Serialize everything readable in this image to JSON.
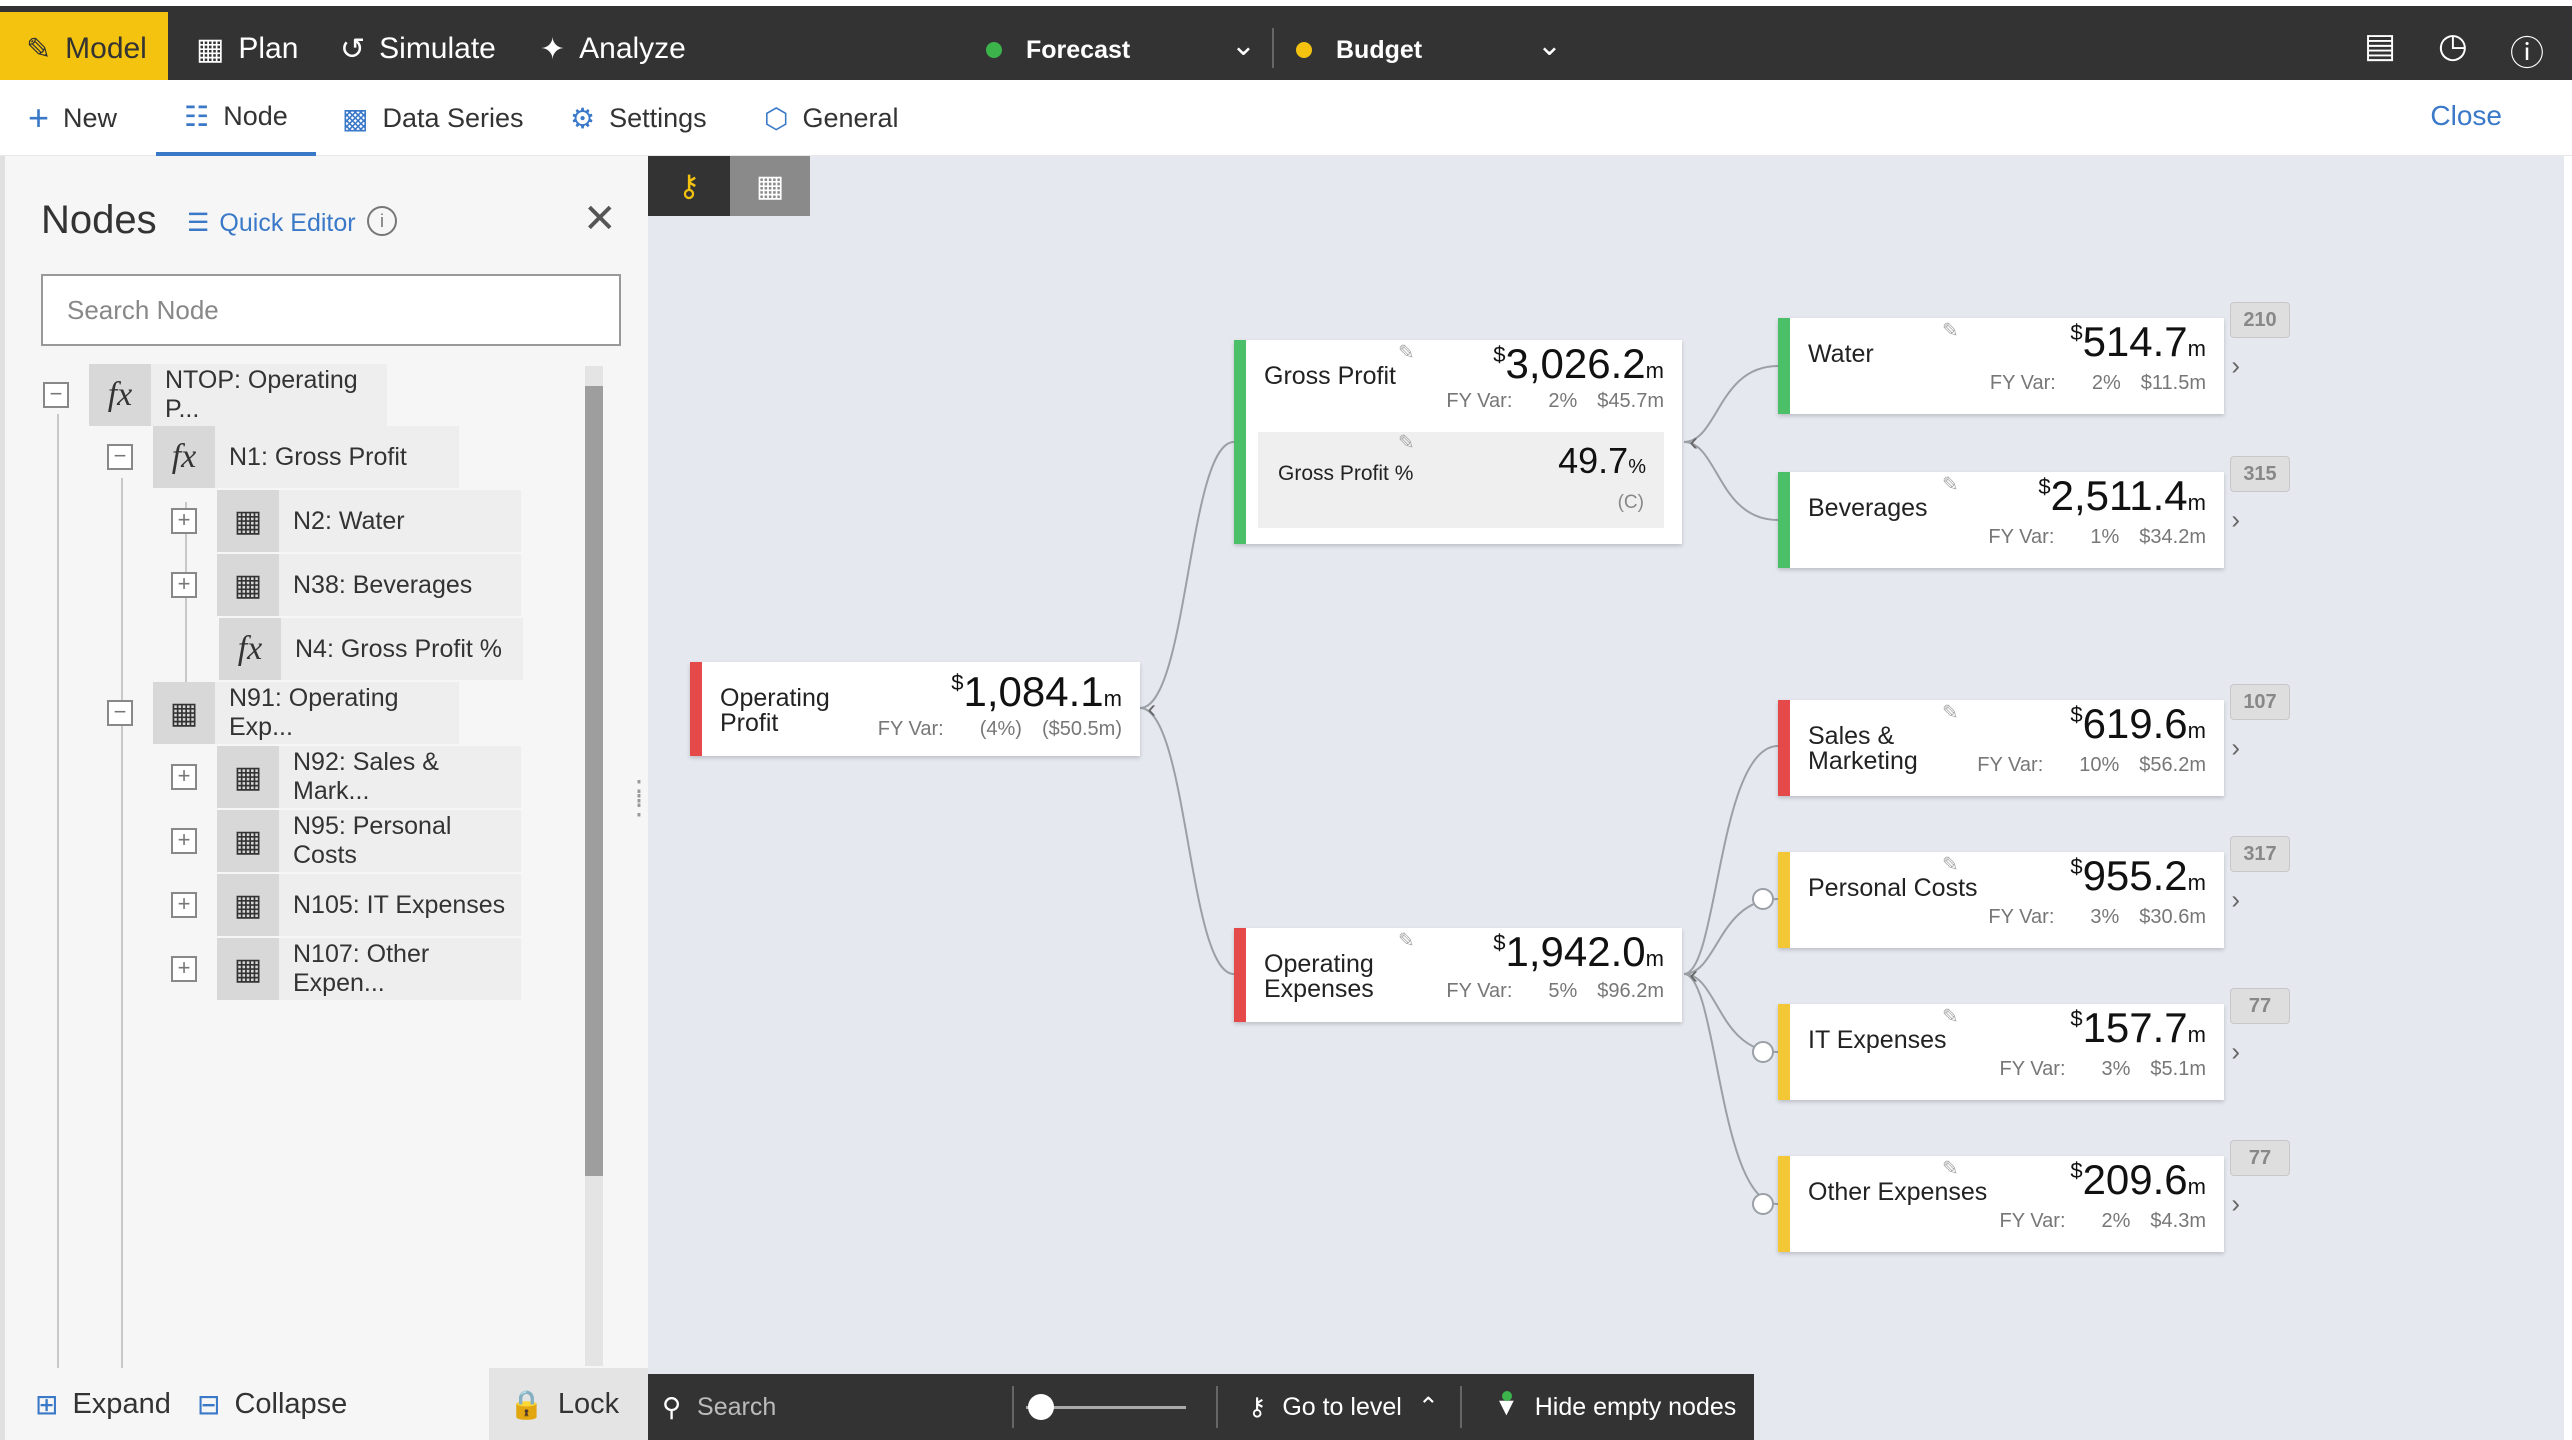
{
  "topnav": {
    "tabs": [
      {
        "label": "Model",
        "icon": "pencil-icon"
      },
      {
        "label": "Plan",
        "icon": "table-icon"
      },
      {
        "label": "Simulate",
        "icon": "branch-icon"
      },
      {
        "label": "Analyze",
        "icon": "telescope-icon"
      }
    ],
    "scenarios": [
      {
        "label": "Forecast",
        "color": "#3cb44b"
      },
      {
        "label": "Budget",
        "color": "#f3c30f"
      }
    ],
    "accent": "#f3c30f"
  },
  "ribbon": {
    "items": [
      "New",
      "Node",
      "Data Series",
      "Settings",
      "General"
    ],
    "close_label": "Close"
  },
  "panel": {
    "title": "Nodes",
    "quick_editor": "Quick Editor",
    "search_placeholder": "Search Node",
    "tree": [
      {
        "label": "NTOP: Operating P...",
        "icon": "fx"
      },
      {
        "label": "N1: Gross Profit",
        "icon": "fx"
      },
      {
        "label": "N2: Water",
        "icon": "data"
      },
      {
        "label": "N38: Beverages",
        "icon": "data"
      },
      {
        "label": "N4: Gross Profit %",
        "icon": "fx"
      },
      {
        "label": "N91: Operating Exp...",
        "icon": "data"
      },
      {
        "label": "N92: Sales & Mark...",
        "icon": "data"
      },
      {
        "label": "N95: Personal Costs",
        "icon": "data"
      },
      {
        "label": "N105: IT Expenses",
        "icon": "data"
      },
      {
        "label": "N107: Other Expen...",
        "icon": "data"
      }
    ],
    "footer": {
      "expand": "Expand",
      "collapse": "Collapse",
      "lock": "Lock"
    }
  },
  "tree_nodes": {
    "var_label": "FY Var:",
    "operating_profit": {
      "name": "Operating Profit",
      "currency": "$",
      "value": "1,084.1",
      "unit": "m",
      "var_pct": "(4%)",
      "var_abs": "($50.5m)"
    },
    "gross_profit": {
      "name": "Gross Profit",
      "currency": "$",
      "value": "3,026.2",
      "unit": "m",
      "var_pct": "2%",
      "var_abs": "$45.7m",
      "sub_name": "Gross Profit %",
      "sub_value": "49.7",
      "sub_unit": "%",
      "sub_note": "(C)"
    },
    "operating_expenses": {
      "name": "Operating Expenses",
      "currency": "$",
      "value": "1,942.0",
      "unit": "m",
      "var_pct": "5%",
      "var_abs": "$96.2m"
    },
    "water": {
      "name": "Water",
      "currency": "$",
      "value": "514.7",
      "unit": "m",
      "var_pct": "2%",
      "var_abs": "$11.5m",
      "badge": "210"
    },
    "beverages": {
      "name": "Beverages",
      "currency": "$",
      "value": "2,511.4",
      "unit": "m",
      "var_pct": "1%",
      "var_abs": "$34.2m",
      "badge": "315"
    },
    "sales_marketing": {
      "name": "Sales & Marketing",
      "currency": "$",
      "value": "619.6",
      "unit": "m",
      "var_pct": "10%",
      "var_abs": "$56.2m",
      "badge": "107"
    },
    "personal_costs": {
      "name": "Personal Costs",
      "currency": "$",
      "value": "955.2",
      "unit": "m",
      "var_pct": "3%",
      "var_abs": "$30.6m",
      "badge": "317"
    },
    "it_expenses": {
      "name": "IT Expenses",
      "currency": "$",
      "value": "157.7",
      "unit": "m",
      "var_pct": "3%",
      "var_abs": "$5.1m",
      "badge": "77"
    },
    "other_expenses": {
      "name": "Other Expenses",
      "currency": "$",
      "value": "209.6",
      "unit": "m",
      "var_pct": "2%",
      "var_abs": "$4.3m",
      "badge": "77"
    }
  },
  "bottombar": {
    "search_placeholder": "Search",
    "go_to_level": "Go to level",
    "hide_empty": "Hide empty nodes"
  }
}
